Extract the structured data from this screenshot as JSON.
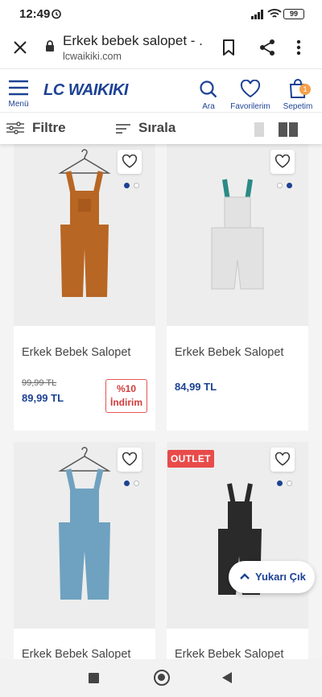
{
  "status": {
    "time": "12:49",
    "battery": "99"
  },
  "browser": {
    "page_title": "Erkek bebek salopet - ...",
    "url": "lcwaikiki.com"
  },
  "header": {
    "menu_label": "Menü",
    "logo": "LC WAIKIKI",
    "search_label": "Ara",
    "favorites_label": "Favorilerim",
    "cart_label": "Sepetim",
    "cart_count": "1"
  },
  "toolbar": {
    "filter_label": "Filtre",
    "sort_label": "Sırala"
  },
  "products": [
    {
      "name": "Erkek Bebek Salopet",
      "old_price": "99,99 TL",
      "price": "89,99 TL",
      "discount_line1": "%10",
      "discount_line2": "İndirim",
      "color": "#b86624"
    },
    {
      "name": "Erkek Bebek Salopet",
      "price": "84,99 TL",
      "color": "#e2e2e2"
    },
    {
      "name": "Erkek Bebek Salopet",
      "color": "#6fa2c0"
    },
    {
      "name": "Erkek Bebek Salopet",
      "badge": "OUTLET",
      "color": "#2a2a2a"
    }
  ],
  "back_to_top": "Yukarı Çık"
}
